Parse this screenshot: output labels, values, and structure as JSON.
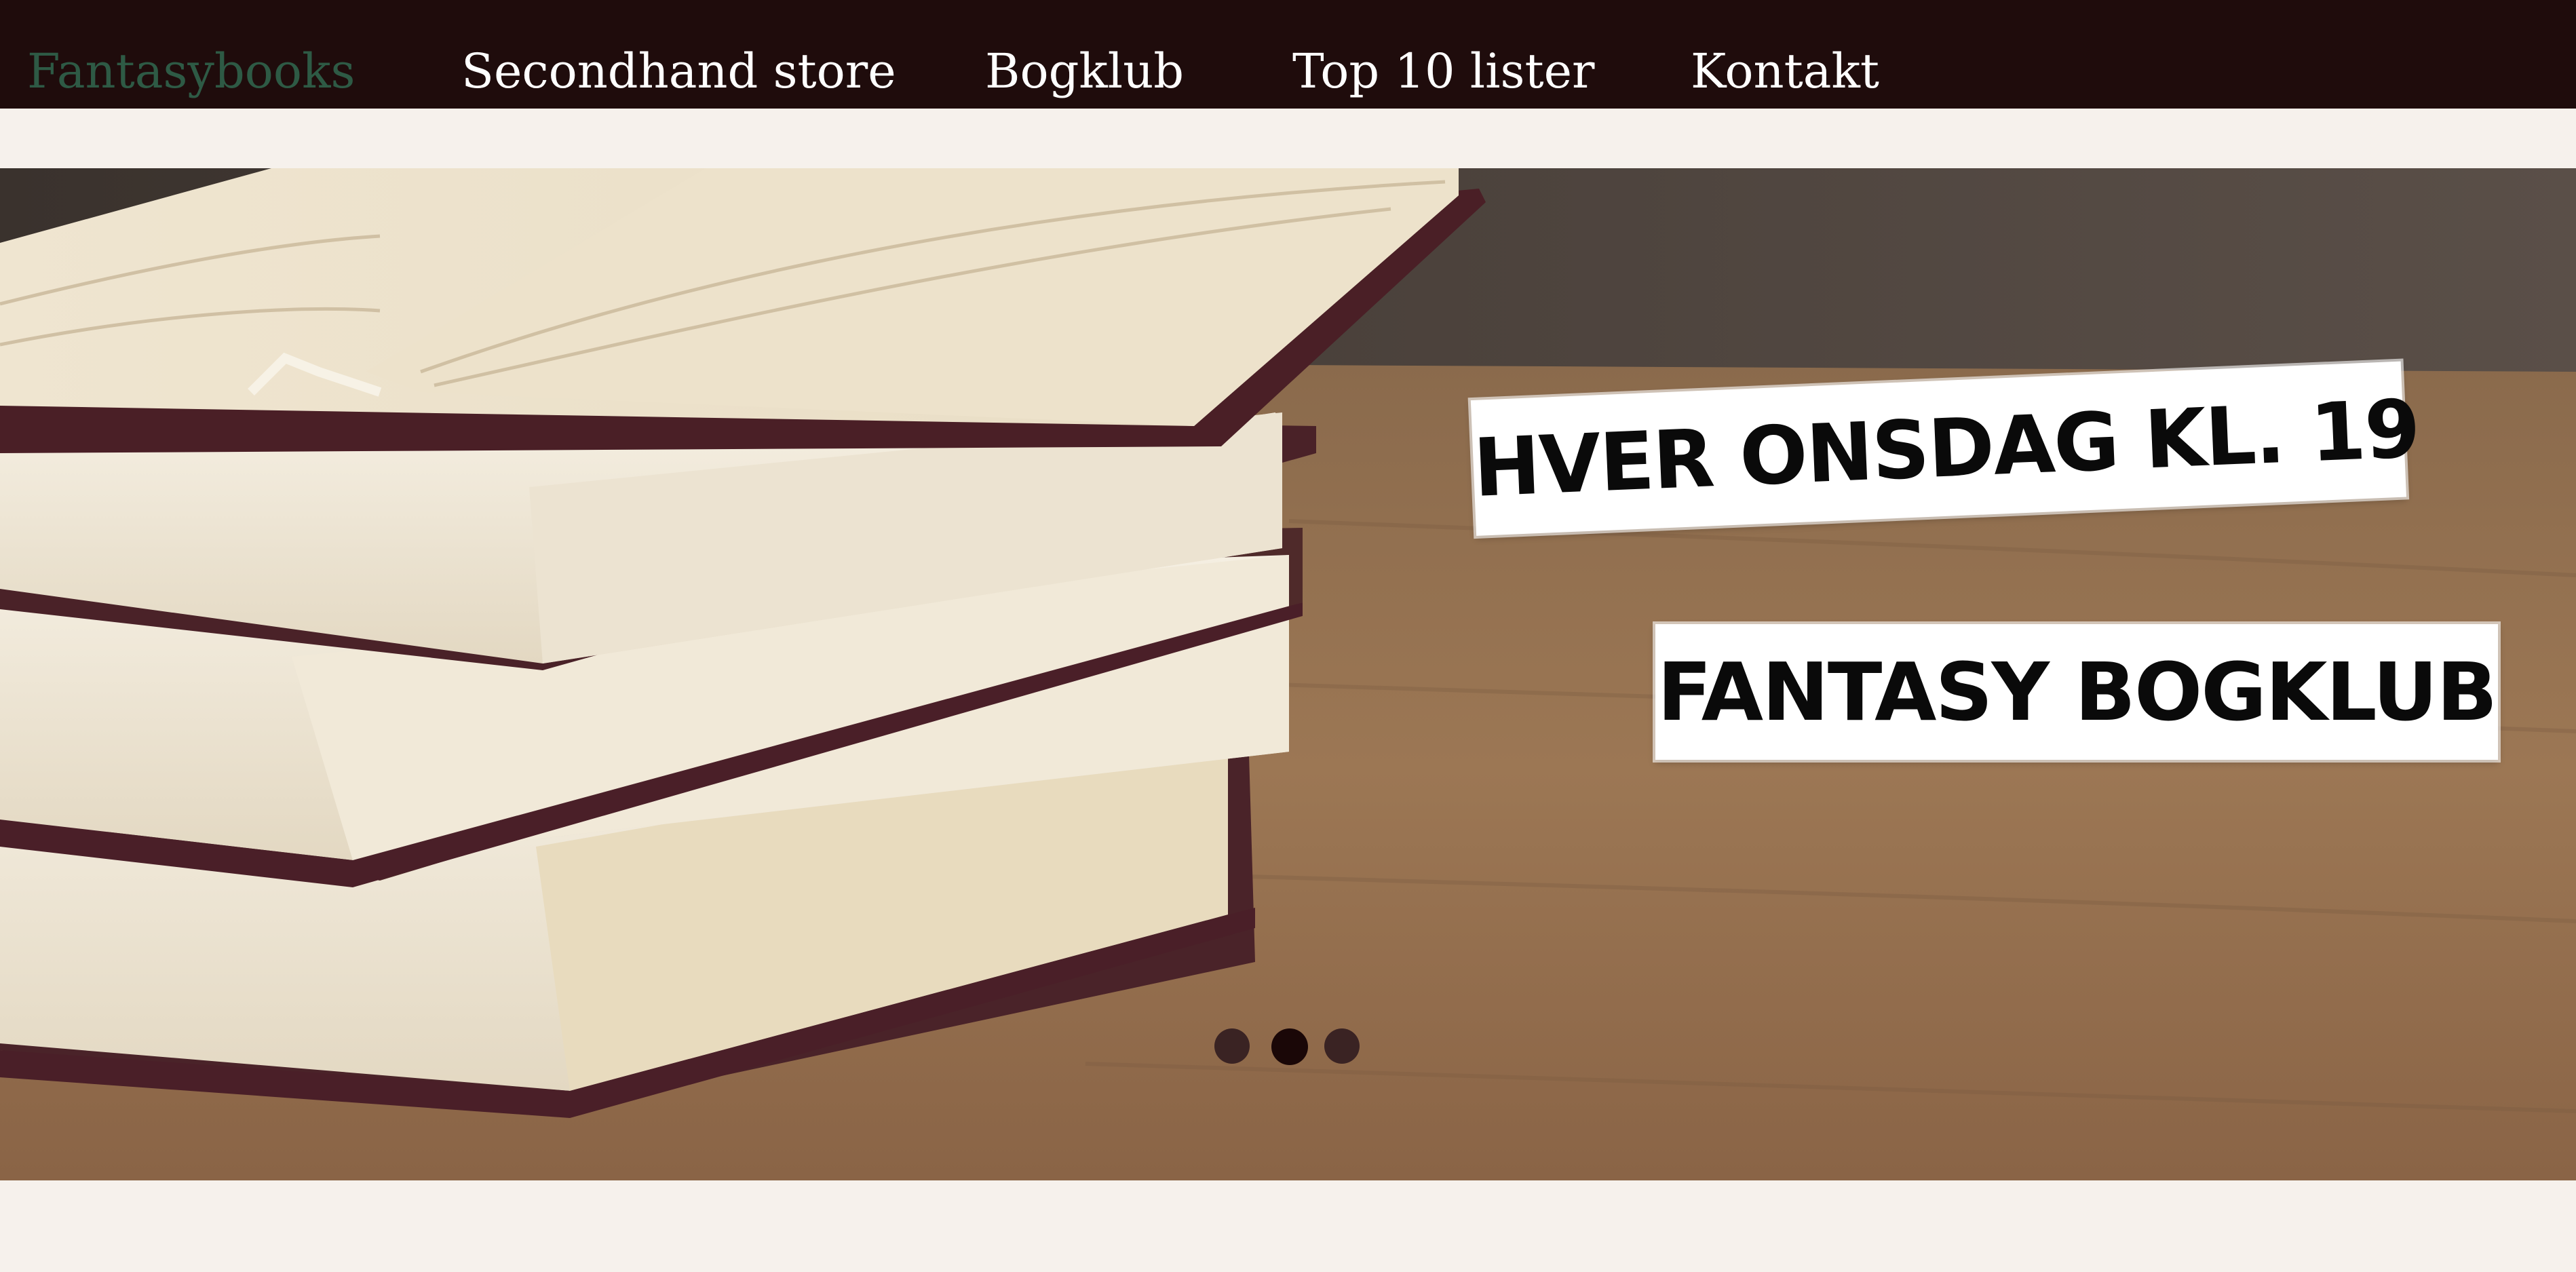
{
  "nav": {
    "brand": "Fantasybooks",
    "items": [
      {
        "label": "Secondhand store"
      },
      {
        "label": "Bogklub"
      },
      {
        "label": "Top 10 lister"
      },
      {
        "label": "Kontakt"
      }
    ]
  },
  "hero": {
    "label_line1": "HVER ONSDAG KL. 19",
    "label_line2": "FANTASY BOGKLUB"
  },
  "carousel": {
    "slide_count": 3,
    "active_slide": 2
  },
  "colors": {
    "nav_background": "#1f0c0c",
    "brand": "#2e5a45",
    "nav_text": "#ffffff",
    "page_background": "#f6f1ec",
    "dot": "#3a2323",
    "dot_active": "#1a0707"
  }
}
